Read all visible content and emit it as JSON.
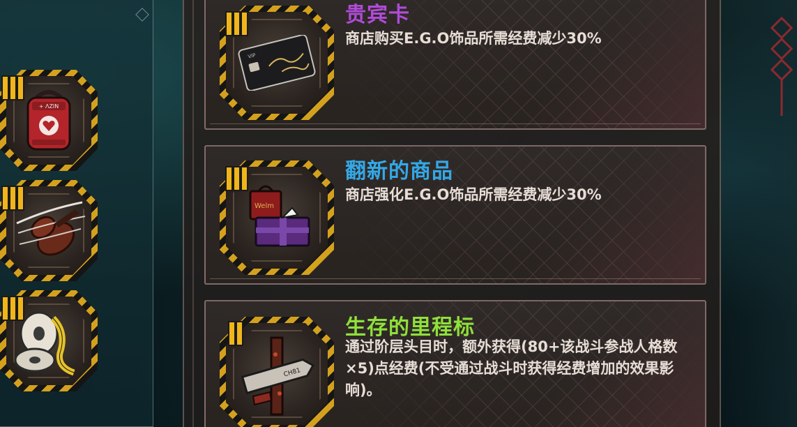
{
  "side_items": [
    {
      "tier": "III",
      "icon": "red-backpack-icon"
    },
    {
      "tier": "III",
      "icon": "broken-violin-icon"
    },
    {
      "tier": "III",
      "icon": "film-reel-icon"
    }
  ],
  "cards": [
    {
      "tier": "III",
      "icon": "vip-card-icon",
      "title": "贵宾卡",
      "title_color": "#b04bd8",
      "description": "商店购买E.G.O饰品所需经费减少30%"
    },
    {
      "tier": "III",
      "icon": "gift-box-icon",
      "title": "翻新的商品",
      "title_color": "#34a8e6",
      "description": "商店强化E.G.O饰品所需经费减少30%"
    },
    {
      "tier": "II",
      "icon": "signpost-icon",
      "title": "生存的里程标",
      "title_color": "#8fe03a",
      "description": "通过阶层头目时，额外获得(80+该战斗参战人格数×5)点经费(不受通过战斗时获得经费增加的效果影响)。"
    }
  ]
}
